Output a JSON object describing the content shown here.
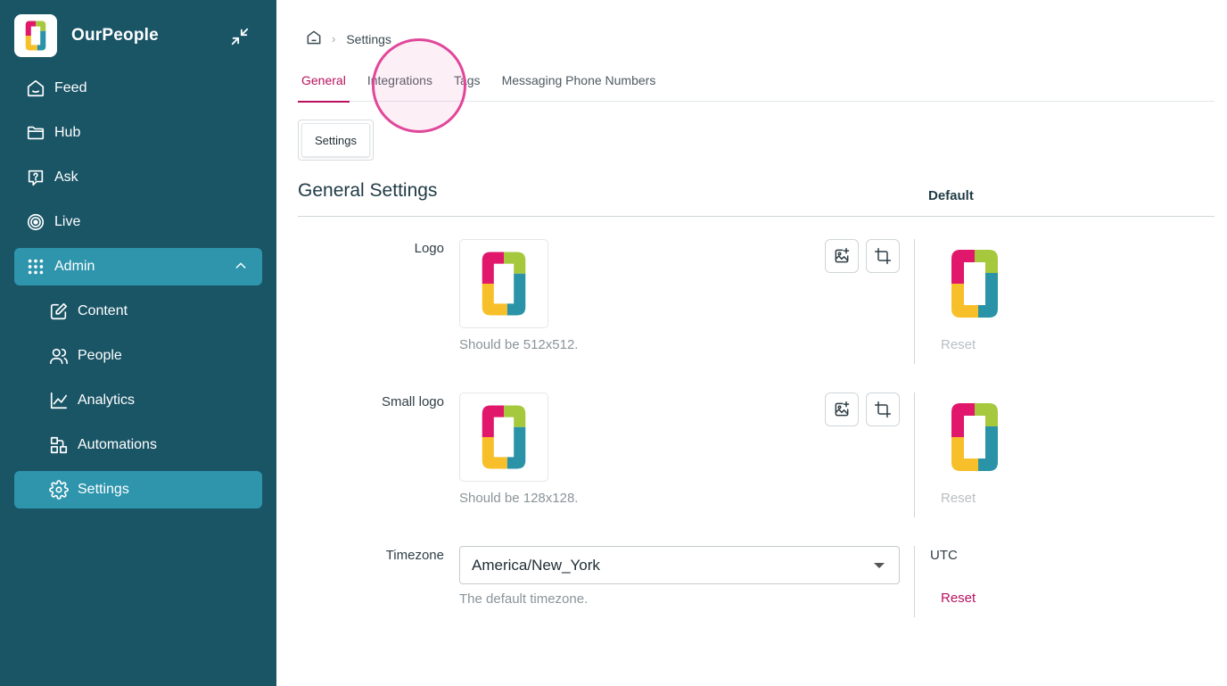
{
  "brand": {
    "name": "OurPeople"
  },
  "sidebar": {
    "items": [
      {
        "label": "Feed",
        "icon": "home-icon"
      },
      {
        "label": "Hub",
        "icon": "folder-icon"
      },
      {
        "label": "Ask",
        "icon": "question-icon"
      },
      {
        "label": "Live",
        "icon": "target-icon"
      },
      {
        "label": "Admin",
        "icon": "grid-dots-icon",
        "expanded": true
      },
      {
        "label": "Content",
        "icon": "edit-icon"
      },
      {
        "label": "People",
        "icon": "users-icon"
      },
      {
        "label": "Analytics",
        "icon": "chart-line-icon"
      },
      {
        "label": "Automations",
        "icon": "flow-icon"
      },
      {
        "label": "Settings",
        "icon": "gear-icon",
        "active": true
      }
    ]
  },
  "breadcrumb": {
    "current": "Settings"
  },
  "tabs": [
    {
      "label": "General",
      "active": true
    },
    {
      "label": "Integrations"
    },
    {
      "label": "Tags"
    },
    {
      "label": "Messaging Phone Numbers"
    }
  ],
  "subtab": {
    "label": "Settings"
  },
  "section": {
    "title": "General Settings",
    "default_header": "Default"
  },
  "rows": {
    "logo": {
      "label": "Logo",
      "hint": "Should be 512x512.",
      "reset": "Reset"
    },
    "small_logo": {
      "label": "Small logo",
      "hint": "Should be 128x128.",
      "reset": "Reset"
    },
    "timezone": {
      "label": "Timezone",
      "value": "America/New_York",
      "hint": "The default timezone.",
      "default_value": "UTC",
      "reset": "Reset"
    }
  },
  "colors": {
    "sidebar": "#1a5566",
    "active_nav": "#2e95ad",
    "accent": "#b8125f",
    "logo_magenta": "#e0176b",
    "logo_green": "#a6c83c",
    "logo_teal": "#2a93a8",
    "logo_yellow": "#f7c02a"
  }
}
